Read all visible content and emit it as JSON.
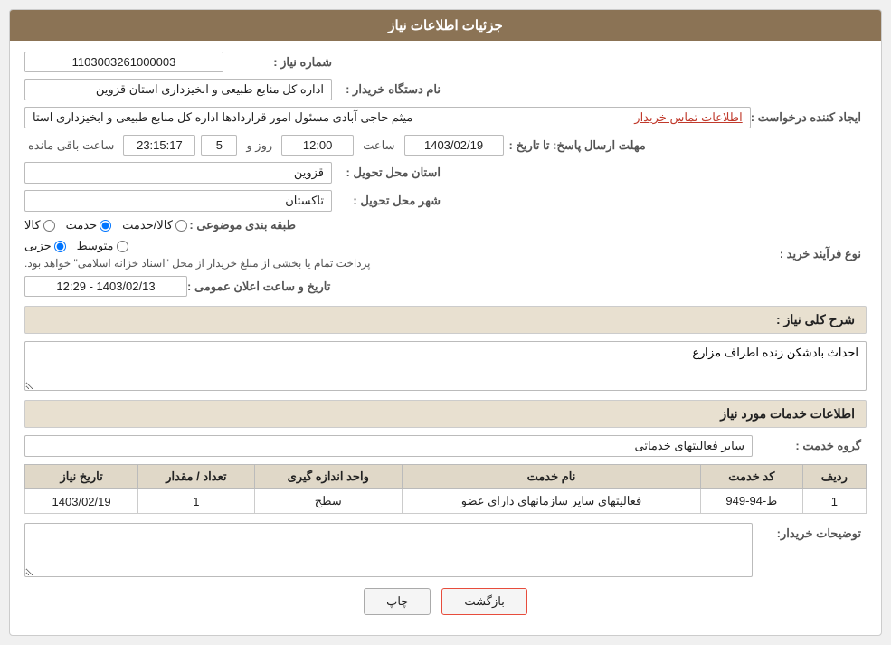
{
  "header": {
    "title": "جزئیات اطلاعات نیاز"
  },
  "fields": {
    "need_number_label": "شماره نیاز :",
    "need_number_value": "1103003261000003",
    "buyer_org_label": "نام دستگاه خریدار :",
    "buyer_org_value": "اداره کل منابع طبیعی و ابخیزداری استان قزوین",
    "requester_label": "ایجاد کننده درخواست :",
    "requester_value": "میثم حاجی آبادی مسئول امور قراردادها اداره کل منابع طبیعی و ابخیزداری استا",
    "requester_link": "اطلاعات تماس خریدار",
    "deadline_label": "مهلت ارسال پاسخ: تا تاریخ :",
    "deadline_date": "1403/02/19",
    "deadline_time_label": "ساعت",
    "deadline_time": "12:00",
    "deadline_day_label": "روز و",
    "deadline_days": "5",
    "deadline_remaining_label": "ساعت باقی مانده",
    "deadline_remaining": "23:15:17",
    "province_label": "استان محل تحویل :",
    "province_value": "قزوین",
    "city_label": "شهر محل تحویل :",
    "city_value": "تاکستان",
    "category_label": "طبقه بندی موضوعی :",
    "category_options": [
      "کالا",
      "خدمت",
      "کالا/خدمت"
    ],
    "category_selected": "خدمت",
    "process_label": "نوع فرآیند خرید :",
    "process_options": [
      "جزیی",
      "متوسط"
    ],
    "process_note": "پرداخت تمام یا بخشی از مبلغ خریدار از محل \"اسناد خزانه اسلامی\" خواهد بود.",
    "announce_label": "تاریخ و ساعت اعلان عمومی :",
    "announce_value": "1403/02/13 - 12:29"
  },
  "need_description": {
    "section_label": "شرح کلی نیاز :",
    "value": "احداث بادشکن زنده اطراف مزارع"
  },
  "services_info": {
    "section_label": "اطلاعات خدمات مورد نیاز",
    "service_group_label": "گروه خدمت :",
    "service_group_value": "سایر فعالیتهای خدماتی",
    "table": {
      "columns": [
        "ردیف",
        "کد خدمت",
        "نام خدمت",
        "واحد اندازه گیری",
        "تعداد / مقدار",
        "تاریخ نیاز"
      ],
      "rows": [
        {
          "row_num": "1",
          "service_code": "ط-94-949",
          "service_name": "فعالیتهای سایر سازمانهای دارای عضو",
          "unit": "سطح",
          "quantity": "1",
          "date": "1403/02/19"
        }
      ]
    }
  },
  "buyer_notes": {
    "label": "توضیحات خریدار:",
    "value": ""
  },
  "buttons": {
    "print": "چاپ",
    "back": "بازگشت"
  }
}
